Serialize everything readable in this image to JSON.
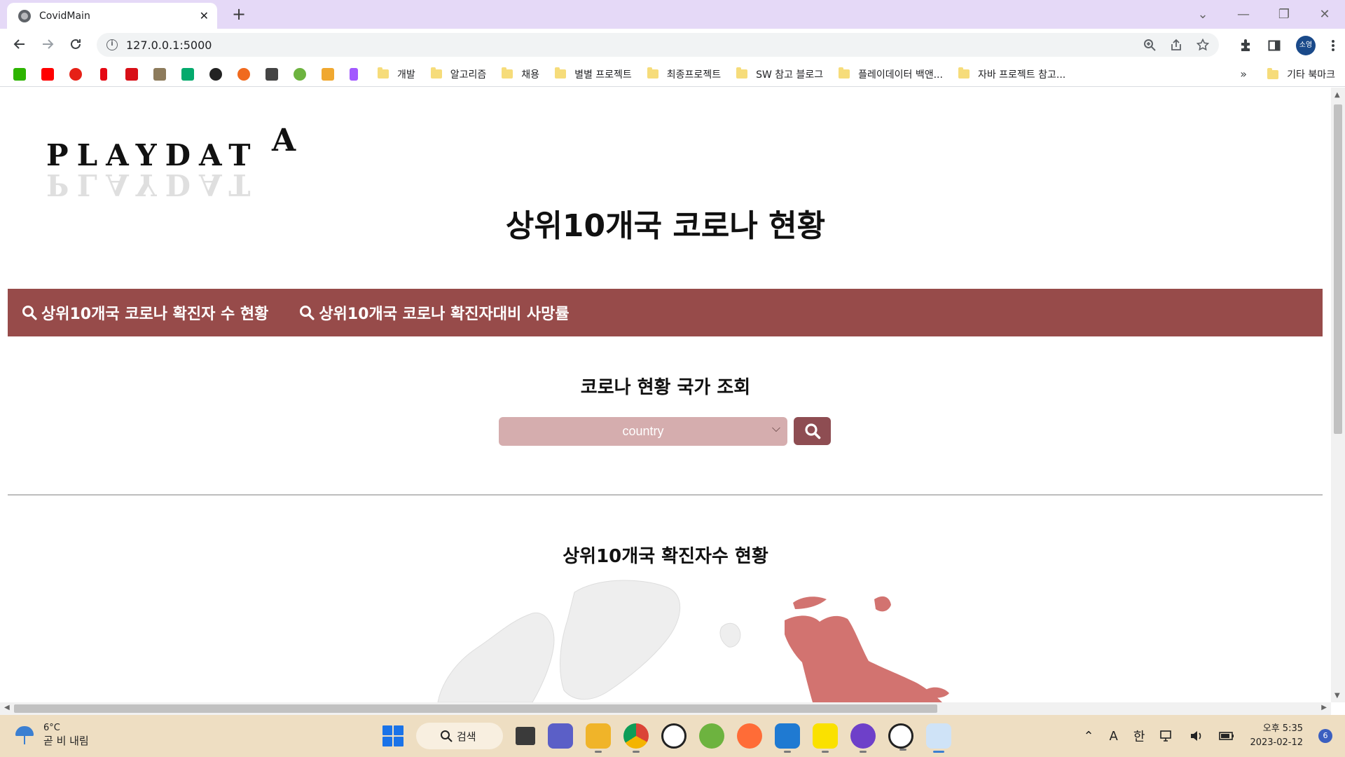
{
  "browser": {
    "tab_title": "CovidMain",
    "tab_close": "✕",
    "new_tab": "+",
    "url": "127.0.0.1:5000",
    "profile_initials": "소영",
    "window_controls": [
      "⌄",
      "—",
      "❐",
      "✕"
    ],
    "bookmarks_more": "»",
    "bookmark_icons": [
      {
        "name": "naver-icon",
        "color": "#2db400"
      },
      {
        "name": "youtube-icon",
        "color": "#ff0000"
      },
      {
        "name": "youtube-music-icon",
        "color": "#e62117"
      },
      {
        "name": "netflix-icon",
        "color": "#e50914"
      },
      {
        "name": "tving-icon",
        "color": "#d80f17"
      },
      {
        "name": "image-icon",
        "color": "#8d7b5c"
      },
      {
        "name": "w3schools-icon",
        "color": "#04aa6d"
      },
      {
        "name": "app-icon",
        "color": "#222222"
      },
      {
        "name": "tool-icon",
        "color": "#f06a1e"
      },
      {
        "name": "terminal-icon",
        "color": "#444444"
      },
      {
        "name": "spring-icon",
        "color": "#6db33f"
      },
      {
        "name": "box-icon",
        "color": "#f0a830"
      },
      {
        "name": "figma-icon",
        "color": "#a259ff"
      }
    ],
    "bookmark_folders": [
      "개발",
      "알고리즘",
      "채용",
      "별별 프로젝트",
      "최종프로젝트",
      "SW 참고 블로그",
      "플레이데이터 백앤...",
      "자바 프로젝트 참고..."
    ],
    "bookmark_other": "기타 북마크"
  },
  "page": {
    "logo_text": "PLAYDAT",
    "logo_accent": "A",
    "title": "상위10개국 코로나 현황",
    "nav": [
      {
        "label": "상위10개국 코로나 확진자 수 현황"
      },
      {
        "label": "상위10개국 코로나 확진자대비 사망률"
      }
    ],
    "search_heading": "코로나 현황 국가 조회",
    "country_select": "country",
    "section_title": "상위10개국 확진자수 현황",
    "colors": {
      "accent": "#974b4a",
      "select_bg": "#d5adae",
      "button": "#8e4d52",
      "map_highlight": "#d27370",
      "map_base": "#eeeeee"
    }
  },
  "taskbar": {
    "temperature": "6°C",
    "weather_desc": "곧 비 내림",
    "search_label": "검색",
    "apps": [
      {
        "name": "task-view-icon",
        "color": "#3a3a3a"
      },
      {
        "name": "chat-icon",
        "color": "#5b5fc7"
      },
      {
        "name": "file-explorer-icon",
        "color": "#f0b429"
      },
      {
        "name": "chrome-icon",
        "color": "#1a73e8"
      },
      {
        "name": "panda-app-icon",
        "color": "#ffffff"
      },
      {
        "name": "spring-tool-icon",
        "color": "#6db33f"
      },
      {
        "name": "postman-icon",
        "color": "#ff6c37"
      },
      {
        "name": "vscode-icon",
        "color": "#1f7ad2"
      },
      {
        "name": "kakaotalk-icon",
        "color": "#fae100"
      },
      {
        "name": "github-desktop-icon",
        "color": "#6e40c9"
      },
      {
        "name": "panda-app-2-icon",
        "color": "#ffffff"
      },
      {
        "name": "snipping-tool-icon",
        "color": "#3b7fd1"
      }
    ],
    "ime_mode": "A",
    "ime_lang": "한",
    "clock_time": "오후 5:35",
    "clock_date": "2023-02-12",
    "notifications": "6"
  }
}
